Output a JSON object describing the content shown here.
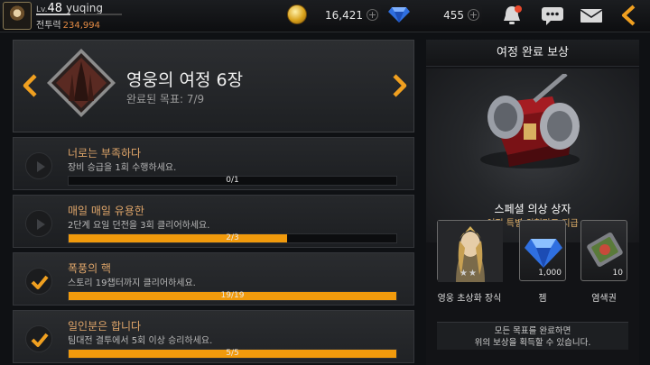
{
  "player": {
    "level_label": "Lv.",
    "level": "48",
    "name": "yuqing",
    "power_label": "전투력",
    "power": "234,994"
  },
  "currency": {
    "gold": "16,421",
    "gems": "455"
  },
  "top_icons": [
    "bell-icon",
    "chat-icon",
    "mail-icon",
    "back-icon"
  ],
  "stage": {
    "title": "영웅의 여정 6장",
    "progress_text": "완료된 목표: 7/9"
  },
  "quests": [
    {
      "title": "너로는 부족하다",
      "desc": "장비 승급을 1회 수행하세요.",
      "progress_text": "0/1",
      "progress": 0.0,
      "status": "in-progress"
    },
    {
      "title": "매일 매일 유용한",
      "desc": "2단계 요일 던전을 3회 클리어하세요.",
      "progress_text": "2/3",
      "progress": 0.667,
      "status": "in-progress"
    },
    {
      "title": "폭풍의 핵",
      "desc": "스토리 19챕터까지 클리어하세요.",
      "progress_text": "19/19",
      "progress": 1.0,
      "status": "complete"
    },
    {
      "title": "일인분은 합니다",
      "desc": "팀대전 결투에서 5회 이상 승리하세요.",
      "progress_text": "5/5",
      "progress": 1.0,
      "status": "complete"
    }
  ],
  "reward": {
    "title": "여정 완료 보상",
    "main_name": "스페셜 의상 상자",
    "main_desc": "여정 특별 외형망토 지급",
    "items": [
      {
        "label": "영웅 초상화 장식",
        "count": "",
        "stars": "★★"
      },
      {
        "label": "젬",
        "count": "1,000"
      },
      {
        "label": "염색권",
        "count": "10"
      }
    ],
    "notice_line1": "모든 목표를 완료하면",
    "notice_line2": "위의 보상을 획득할 수 있습니다."
  },
  "colors": {
    "accent_orange": "#f19a0c",
    "quest_title": "#e0a66a",
    "power_value": "#e38a44"
  }
}
